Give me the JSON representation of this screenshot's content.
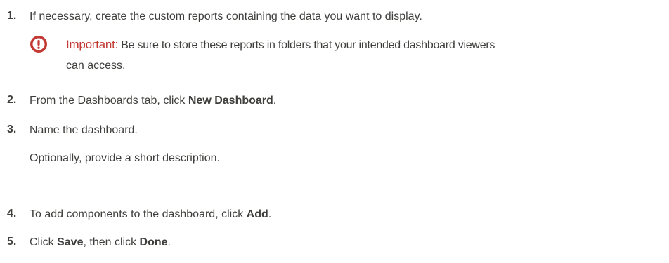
{
  "steps": [
    {
      "number": "1.",
      "text": "If necessary, create the custom reports containing the data you want to display."
    },
    {
      "number": "2.",
      "before": "From the Dashboards tab, click ",
      "bold": "New Dashboard",
      "after": "."
    },
    {
      "number": "3.",
      "text": "Name the dashboard.",
      "subtext": "Optionally, provide a short description."
    },
    {
      "number": "4.",
      "before": "To add components to the dashboard, click ",
      "bold": "Add",
      "after": "."
    },
    {
      "number": "5.",
      "before": "Click ",
      "bold": "Save",
      "middle": ", then click ",
      "bold2": "Done",
      "after": "."
    }
  ],
  "note": {
    "icon": "warning-icon",
    "label": "Important:",
    "line1": "Be sure to store these reports in folders that your intended dashboard viewers",
    "line2": "can access."
  },
  "colors": {
    "text": "#3e3e3c",
    "important": "#c23934"
  }
}
